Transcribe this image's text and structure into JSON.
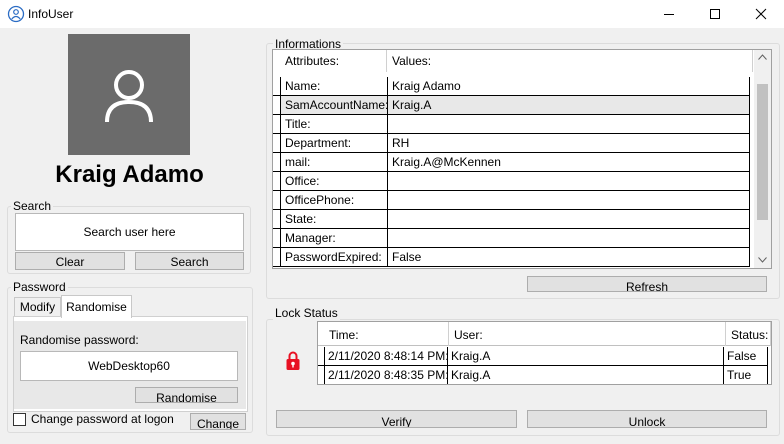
{
  "window": {
    "title": "InfoUser"
  },
  "profile": {
    "display_name": "Kraig Adamo"
  },
  "search": {
    "group_label": "Search",
    "placeholder": "Search user here",
    "clear_label": "Clear",
    "search_label": "Search"
  },
  "password": {
    "group_label": "Password",
    "tabs": [
      {
        "label": "Modify"
      },
      {
        "label": "Randomise"
      }
    ],
    "randomise_label": "Randomise password:",
    "generated_value": "WebDesktop60",
    "randomise_button": "Randomise",
    "change_at_logon_label": "Change password at logon",
    "change_at_logon_checked": false,
    "change_button": "Change"
  },
  "informations": {
    "group_label": "Informations",
    "columns": [
      "Attributes:",
      "Values:"
    ],
    "rows": [
      {
        "attribute": "Name:",
        "value": "Kraig Adamo"
      },
      {
        "attribute": "SamAccountName:",
        "value": "Kraig.A"
      },
      {
        "attribute": "Title:",
        "value": ""
      },
      {
        "attribute": "Department:",
        "value": "RH"
      },
      {
        "attribute": "mail:",
        "value": "Kraig.A@McKennen"
      },
      {
        "attribute": "Office:",
        "value": ""
      },
      {
        "attribute": "OfficePhone:",
        "value": ""
      },
      {
        "attribute": "State:",
        "value": ""
      },
      {
        "attribute": "Manager:",
        "value": ""
      },
      {
        "attribute": "PasswordExpired:",
        "value": "False"
      }
    ],
    "refresh_label": "Refresh"
  },
  "lock_status": {
    "group_label": "Lock Status",
    "lock_icon_color": "#e81123",
    "columns": [
      "Time:",
      "User:",
      "Status:"
    ],
    "rows": [
      {
        "time": "2/11/2020 8:48:14 PM:",
        "user": "Kraig.A",
        "status": "False"
      },
      {
        "time": "2/11/2020 8:48:35 PM:",
        "user": "Kraig.A",
        "status": "True"
      }
    ],
    "verify_label": "Verify",
    "unlock_label": "Unlock"
  }
}
